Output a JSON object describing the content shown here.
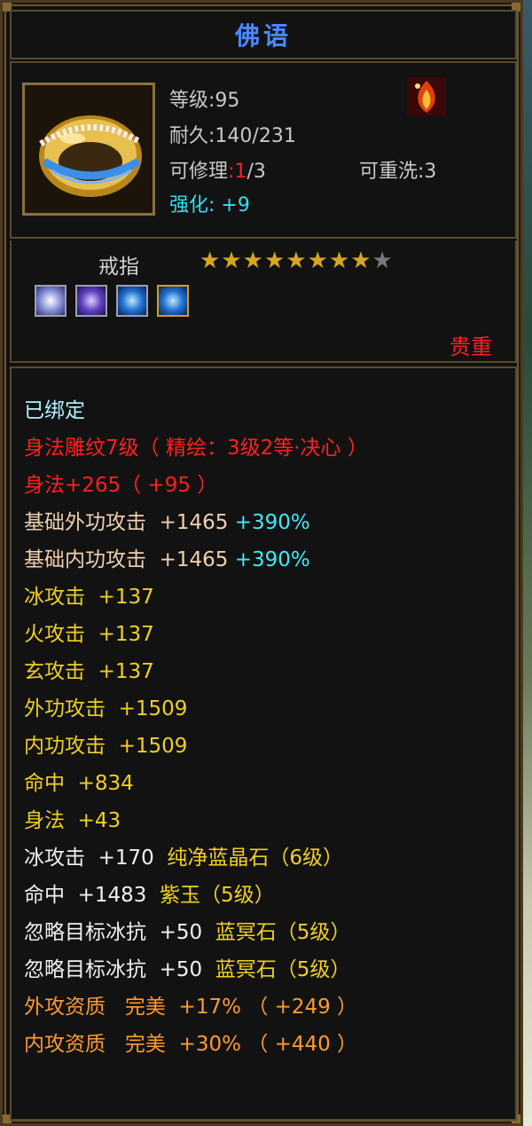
{
  "title": "佛语",
  "item": {
    "level_label": "等级",
    "level": ":95",
    "durability_label": "耐久",
    "durability": ":140/231",
    "repair_label": "可修理",
    "repair_cur": ":1",
    "repair_max": "/3",
    "rewash_label": "可重洗",
    "rewash": ":3",
    "enhance_label": "强化",
    "enhance": ":  +9",
    "type": "戒指",
    "stars_filled": 8,
    "stars_total": 9,
    "precious": "贵重"
  },
  "attributes": [
    {
      "text": "已绑定",
      "color": "cyan"
    },
    {
      "text": "身法雕纹7级（ 精绘：3级2等·决心 ）",
      "color": "red"
    },
    {
      "text": "身法+265（ +95 ）",
      "color": "red"
    },
    {
      "text": "基础外功攻击  +1465",
      "extra": " +390%",
      "color": "tan"
    },
    {
      "text": "基础内功攻击  +1465",
      "extra": " +390%",
      "color": "tan"
    },
    {
      "text": "冰攻击  +137",
      "color": "yellow"
    },
    {
      "text": "火攻击  +137",
      "color": "yellow"
    },
    {
      "text": "玄攻击  +137",
      "color": "yellow"
    },
    {
      "text": "外功攻击  +1509",
      "color": "yellow"
    },
    {
      "text": "内功攻击  +1509",
      "color": "yellow"
    },
    {
      "text": "命中  +834",
      "color": "yellow"
    },
    {
      "text": "身法  +43",
      "color": "yellow"
    },
    {
      "text": "冰攻击  +170",
      "extra": "  纯净蓝晶石（6级）",
      "color": "white"
    },
    {
      "text": "命中  +1483",
      "extra": "  紫玉（5级）",
      "color": "white"
    },
    {
      "text": "忽略目标冰抗  +50",
      "extra": "  蓝冥石（5级）",
      "color": "white"
    },
    {
      "text": "忽略目标冰抗  +50",
      "extra": "  蓝冥石（5级）",
      "color": "white"
    },
    {
      "text": "外攻资质   完美  +17% （ +249 ）",
      "color": "orange"
    },
    {
      "text": "内攻资质   完美  +30% （ +440 ）",
      "color": "orange"
    }
  ]
}
